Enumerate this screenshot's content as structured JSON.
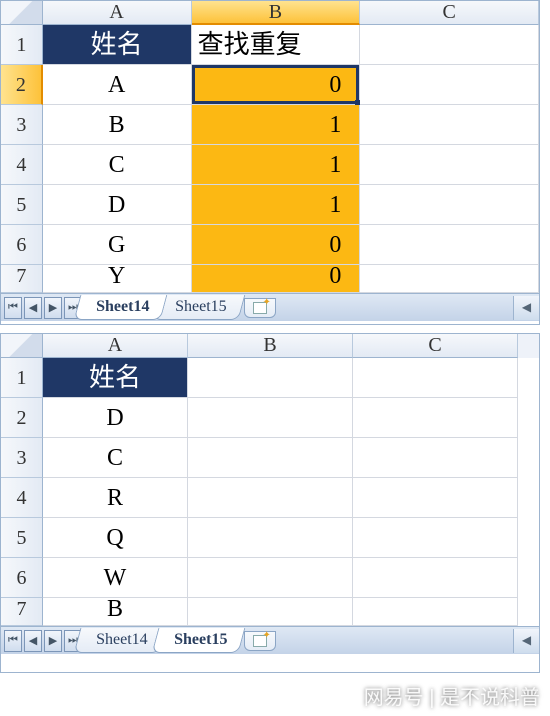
{
  "top": {
    "columns": [
      "A",
      "B",
      "C"
    ],
    "rows": [
      "1",
      "2",
      "3",
      "4",
      "5",
      "6",
      "7"
    ],
    "header": {
      "A": "姓名",
      "B": "查找重复"
    },
    "data": [
      {
        "A": "A",
        "B": "0"
      },
      {
        "A": "B",
        "B": "1"
      },
      {
        "A": "C",
        "B": "1"
      },
      {
        "A": "D",
        "B": "1"
      },
      {
        "A": "G",
        "B": "0"
      },
      {
        "A": "Y",
        "B": "0"
      }
    ],
    "activeCell": "B2",
    "tabs": [
      "Sheet14",
      "Sheet15"
    ],
    "activeTab": 0
  },
  "bottom": {
    "columns": [
      "A",
      "B",
      "C"
    ],
    "rows": [
      "1",
      "2",
      "3",
      "4",
      "5",
      "6",
      "7"
    ],
    "header": {
      "A": "姓名"
    },
    "data": [
      {
        "A": "D"
      },
      {
        "A": "C"
      },
      {
        "A": "R"
      },
      {
        "A": "Q"
      },
      {
        "A": "W"
      },
      {
        "A": "B"
      }
    ],
    "tabs": [
      "Sheet14",
      "Sheet15"
    ],
    "activeTab": 1
  },
  "nav": {
    "first": "⏮",
    "prev": "◀",
    "next": "▶",
    "last": "⏭"
  },
  "watermark": "网易号 | 是不说科普"
}
